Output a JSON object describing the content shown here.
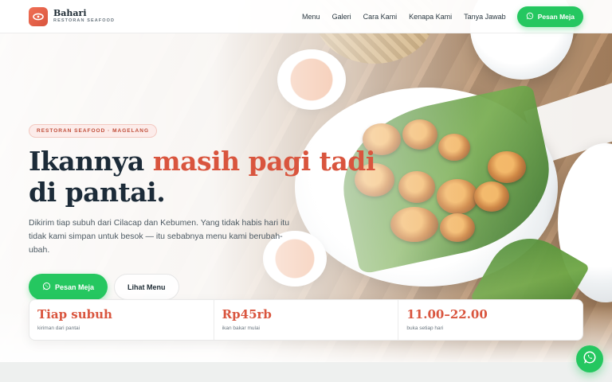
{
  "brand": {
    "name": "Bahari",
    "tagline": "RESTORAN SEAFOOD",
    "accent_color": "#d9553e",
    "whatsapp_color": "#25c760"
  },
  "nav": {
    "items": [
      {
        "label": "Menu"
      },
      {
        "label": "Galeri"
      },
      {
        "label": "Cara Kami"
      },
      {
        "label": "Kenapa Kami"
      },
      {
        "label": "Tanya Jawab"
      }
    ],
    "cta_label": "Pesan Meja",
    "cta_icon": "whatsapp-icon"
  },
  "hero": {
    "eyebrow": "RESTORAN SEAFOOD · MAGELANG",
    "headline_part1": "Ikannya ",
    "headline_accent": "masih pagi tadi",
    "headline_part2": "di pantai.",
    "subtitle": "Dikirim tiap subuh dari Cilacap dan Kebumen. Yang tidak habis hari itu tidak kami simpan untuk besok — itu sebabnya menu kami berubah-ubah.",
    "primary_cta": "Pesan Meja",
    "secondary_cta": "Lihat Menu"
  },
  "stats": [
    {
      "value": "Tiap subuh",
      "label": "kiriman dari pantai"
    },
    {
      "value": "Rp45rb",
      "label": "ikan bakar mulai"
    },
    {
      "value": "11.00–22.00",
      "label": "buka setiap hari"
    }
  ],
  "floating_button": {
    "icon": "whatsapp-icon"
  }
}
